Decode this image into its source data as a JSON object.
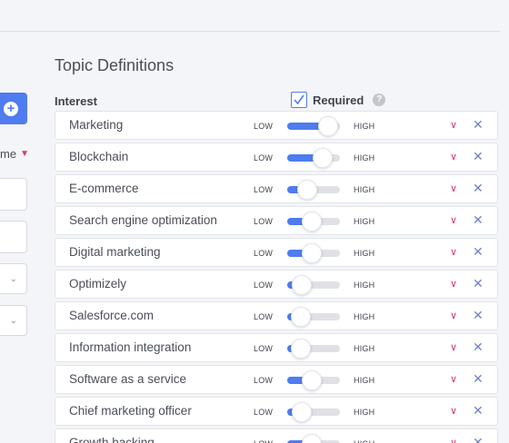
{
  "sidebar": {
    "sort_label": "me",
    "add_icon": "plus-circle-icon",
    "chevron_icon": "chevron-down-icon"
  },
  "section": {
    "title": "Topic Definitions",
    "col_interest": "Interest",
    "required_label": "Required",
    "required_checked": true,
    "help_icon": "?"
  },
  "scale": {
    "low": "LOW",
    "high": "HIGH"
  },
  "colors": {
    "accent": "#4f7cef",
    "chevron": "#e0356a",
    "remove": "#6d83c9"
  },
  "topics": [
    {
      "name": "Marketing",
      "level": 0.95
    },
    {
      "name": "Blockchain",
      "level": 0.78
    },
    {
      "name": "E-commerce",
      "level": 0.3
    },
    {
      "name": "Search engine optimization",
      "level": 0.45
    },
    {
      "name": "Digital marketing",
      "level": 0.45
    },
    {
      "name": "Optimizely",
      "level": 0.15
    },
    {
      "name": "Salesforce.com",
      "level": 0.1
    },
    {
      "name": "Information integration",
      "level": 0.1
    },
    {
      "name": "Software as a service",
      "level": 0.45
    },
    {
      "name": "Chief marketing officer",
      "level": 0.15
    },
    {
      "name": "Growth hacking",
      "level": 0.45
    }
  ]
}
